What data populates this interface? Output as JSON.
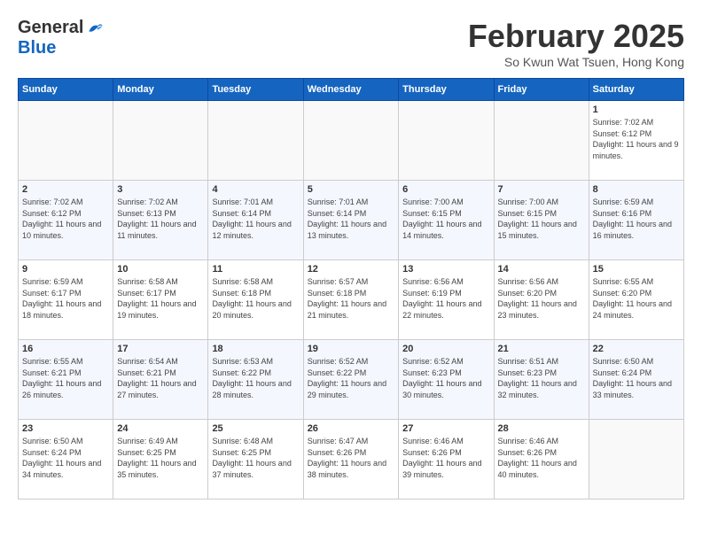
{
  "header": {
    "logo_general": "General",
    "logo_blue": "Blue",
    "title": "February 2025",
    "location": "So Kwun Wat Tsuen, Hong Kong"
  },
  "calendar": {
    "days_of_week": [
      "Sunday",
      "Monday",
      "Tuesday",
      "Wednesday",
      "Thursday",
      "Friday",
      "Saturday"
    ],
    "weeks": [
      [
        {
          "day": "",
          "detail": ""
        },
        {
          "day": "",
          "detail": ""
        },
        {
          "day": "",
          "detail": ""
        },
        {
          "day": "",
          "detail": ""
        },
        {
          "day": "",
          "detail": ""
        },
        {
          "day": "",
          "detail": ""
        },
        {
          "day": "1",
          "detail": "Sunrise: 7:02 AM\nSunset: 6:12 PM\nDaylight: 11 hours and 9 minutes."
        }
      ],
      [
        {
          "day": "2",
          "detail": "Sunrise: 7:02 AM\nSunset: 6:12 PM\nDaylight: 11 hours and 10 minutes."
        },
        {
          "day": "3",
          "detail": "Sunrise: 7:02 AM\nSunset: 6:13 PM\nDaylight: 11 hours and 11 minutes."
        },
        {
          "day": "4",
          "detail": "Sunrise: 7:01 AM\nSunset: 6:14 PM\nDaylight: 11 hours and 12 minutes."
        },
        {
          "day": "5",
          "detail": "Sunrise: 7:01 AM\nSunset: 6:14 PM\nDaylight: 11 hours and 13 minutes."
        },
        {
          "day": "6",
          "detail": "Sunrise: 7:00 AM\nSunset: 6:15 PM\nDaylight: 11 hours and 14 minutes."
        },
        {
          "day": "7",
          "detail": "Sunrise: 7:00 AM\nSunset: 6:15 PM\nDaylight: 11 hours and 15 minutes."
        },
        {
          "day": "8",
          "detail": "Sunrise: 6:59 AM\nSunset: 6:16 PM\nDaylight: 11 hours and 16 minutes."
        }
      ],
      [
        {
          "day": "9",
          "detail": "Sunrise: 6:59 AM\nSunset: 6:17 PM\nDaylight: 11 hours and 18 minutes."
        },
        {
          "day": "10",
          "detail": "Sunrise: 6:58 AM\nSunset: 6:17 PM\nDaylight: 11 hours and 19 minutes."
        },
        {
          "day": "11",
          "detail": "Sunrise: 6:58 AM\nSunset: 6:18 PM\nDaylight: 11 hours and 20 minutes."
        },
        {
          "day": "12",
          "detail": "Sunrise: 6:57 AM\nSunset: 6:18 PM\nDaylight: 11 hours and 21 minutes."
        },
        {
          "day": "13",
          "detail": "Sunrise: 6:56 AM\nSunset: 6:19 PM\nDaylight: 11 hours and 22 minutes."
        },
        {
          "day": "14",
          "detail": "Sunrise: 6:56 AM\nSunset: 6:20 PM\nDaylight: 11 hours and 23 minutes."
        },
        {
          "day": "15",
          "detail": "Sunrise: 6:55 AM\nSunset: 6:20 PM\nDaylight: 11 hours and 24 minutes."
        }
      ],
      [
        {
          "day": "16",
          "detail": "Sunrise: 6:55 AM\nSunset: 6:21 PM\nDaylight: 11 hours and 26 minutes."
        },
        {
          "day": "17",
          "detail": "Sunrise: 6:54 AM\nSunset: 6:21 PM\nDaylight: 11 hours and 27 minutes."
        },
        {
          "day": "18",
          "detail": "Sunrise: 6:53 AM\nSunset: 6:22 PM\nDaylight: 11 hours and 28 minutes."
        },
        {
          "day": "19",
          "detail": "Sunrise: 6:52 AM\nSunset: 6:22 PM\nDaylight: 11 hours and 29 minutes."
        },
        {
          "day": "20",
          "detail": "Sunrise: 6:52 AM\nSunset: 6:23 PM\nDaylight: 11 hours and 30 minutes."
        },
        {
          "day": "21",
          "detail": "Sunrise: 6:51 AM\nSunset: 6:23 PM\nDaylight: 11 hours and 32 minutes."
        },
        {
          "day": "22",
          "detail": "Sunrise: 6:50 AM\nSunset: 6:24 PM\nDaylight: 11 hours and 33 minutes."
        }
      ],
      [
        {
          "day": "23",
          "detail": "Sunrise: 6:50 AM\nSunset: 6:24 PM\nDaylight: 11 hours and 34 minutes."
        },
        {
          "day": "24",
          "detail": "Sunrise: 6:49 AM\nSunset: 6:25 PM\nDaylight: 11 hours and 35 minutes."
        },
        {
          "day": "25",
          "detail": "Sunrise: 6:48 AM\nSunset: 6:25 PM\nDaylight: 11 hours and 37 minutes."
        },
        {
          "day": "26",
          "detail": "Sunrise: 6:47 AM\nSunset: 6:26 PM\nDaylight: 11 hours and 38 minutes."
        },
        {
          "day": "27",
          "detail": "Sunrise: 6:46 AM\nSunset: 6:26 PM\nDaylight: 11 hours and 39 minutes."
        },
        {
          "day": "28",
          "detail": "Sunrise: 6:46 AM\nSunset: 6:26 PM\nDaylight: 11 hours and 40 minutes."
        },
        {
          "day": "",
          "detail": ""
        }
      ]
    ]
  }
}
